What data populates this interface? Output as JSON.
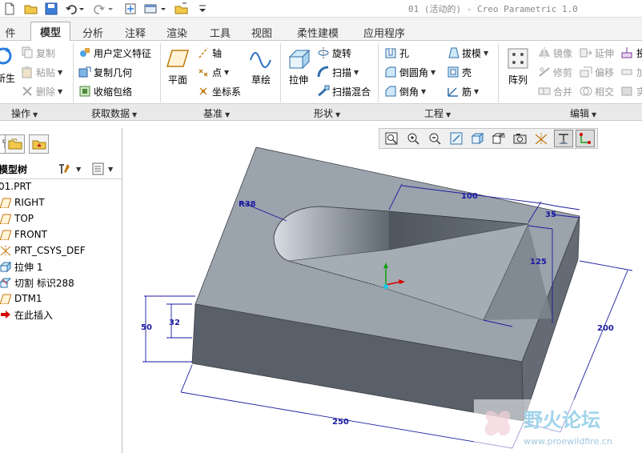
{
  "window": {
    "title": "01 (活动的) - Creo Parametric 1.0"
  },
  "tabs": [
    {
      "label": "件"
    },
    {
      "label": "模型"
    },
    {
      "label": "分析"
    },
    {
      "label": "注释"
    },
    {
      "label": "渲染"
    },
    {
      "label": "工具"
    },
    {
      "label": "视图"
    },
    {
      "label": "柔性建模"
    },
    {
      "label": "应用程序"
    }
  ],
  "ribbon": {
    "operations": {
      "regen_label": "新生",
      "copy": "复制",
      "paste": "粘贴",
      "delete": "删除"
    },
    "get_data": {
      "udf": "用户定义特征",
      "copy_geom": "复制几何",
      "shrinkwrap": "收缩包络"
    },
    "datum": {
      "plane": "平面",
      "axis": "轴",
      "point": "点",
      "csys": "坐标系",
      "sketch": "草绘"
    },
    "shapes": {
      "extrude": "拉伸",
      "revolve": "旋转",
      "sweep": "扫描",
      "swept_blend": "扫描混合"
    },
    "engineering": {
      "hole": "孔",
      "round": "倒圆角",
      "chamfer": "倒角",
      "draft": "拔模",
      "shell": "壳",
      "rib": "筋"
    },
    "editing": {
      "pattern": "阵列",
      "mirror": "镜像",
      "trim": "修剪",
      "merge": "合并",
      "extend": "延伸",
      "offset": "偏移",
      "intersect": "相交",
      "project": "投",
      "thicken": "加",
      "solidify": "实"
    }
  },
  "groups": {
    "operations": "操作",
    "get_data": "获取数据",
    "datum": "基准",
    "shapes": "形状",
    "engineering": "工程",
    "editing": "编辑"
  },
  "model_tree": {
    "title": "模型树",
    "items": [
      {
        "label": "01.PRT"
      },
      {
        "label": "RIGHT"
      },
      {
        "label": "TOP"
      },
      {
        "label": "FRONT"
      },
      {
        "label": "PRT_CSYS_DEF"
      },
      {
        "label": "拉伸 1"
      },
      {
        "label": "切割 标识288"
      },
      {
        "label": "DTM1"
      },
      {
        "label": "在此插入"
      }
    ]
  },
  "dimensions": {
    "radius": "R38",
    "slot_length": "100",
    "end_offset": "35",
    "slot_width": "125",
    "depth_total": "50",
    "cut_depth": "32",
    "width": "200",
    "length": "250"
  },
  "colors": {
    "tab_bg": "#f3f3f3",
    "group_bar": "#e9e9e9",
    "top_face": "#9ba3ac",
    "side_face": "#585e67",
    "dimension": "#1a1aa0",
    "arrow_red": "#d40000"
  }
}
